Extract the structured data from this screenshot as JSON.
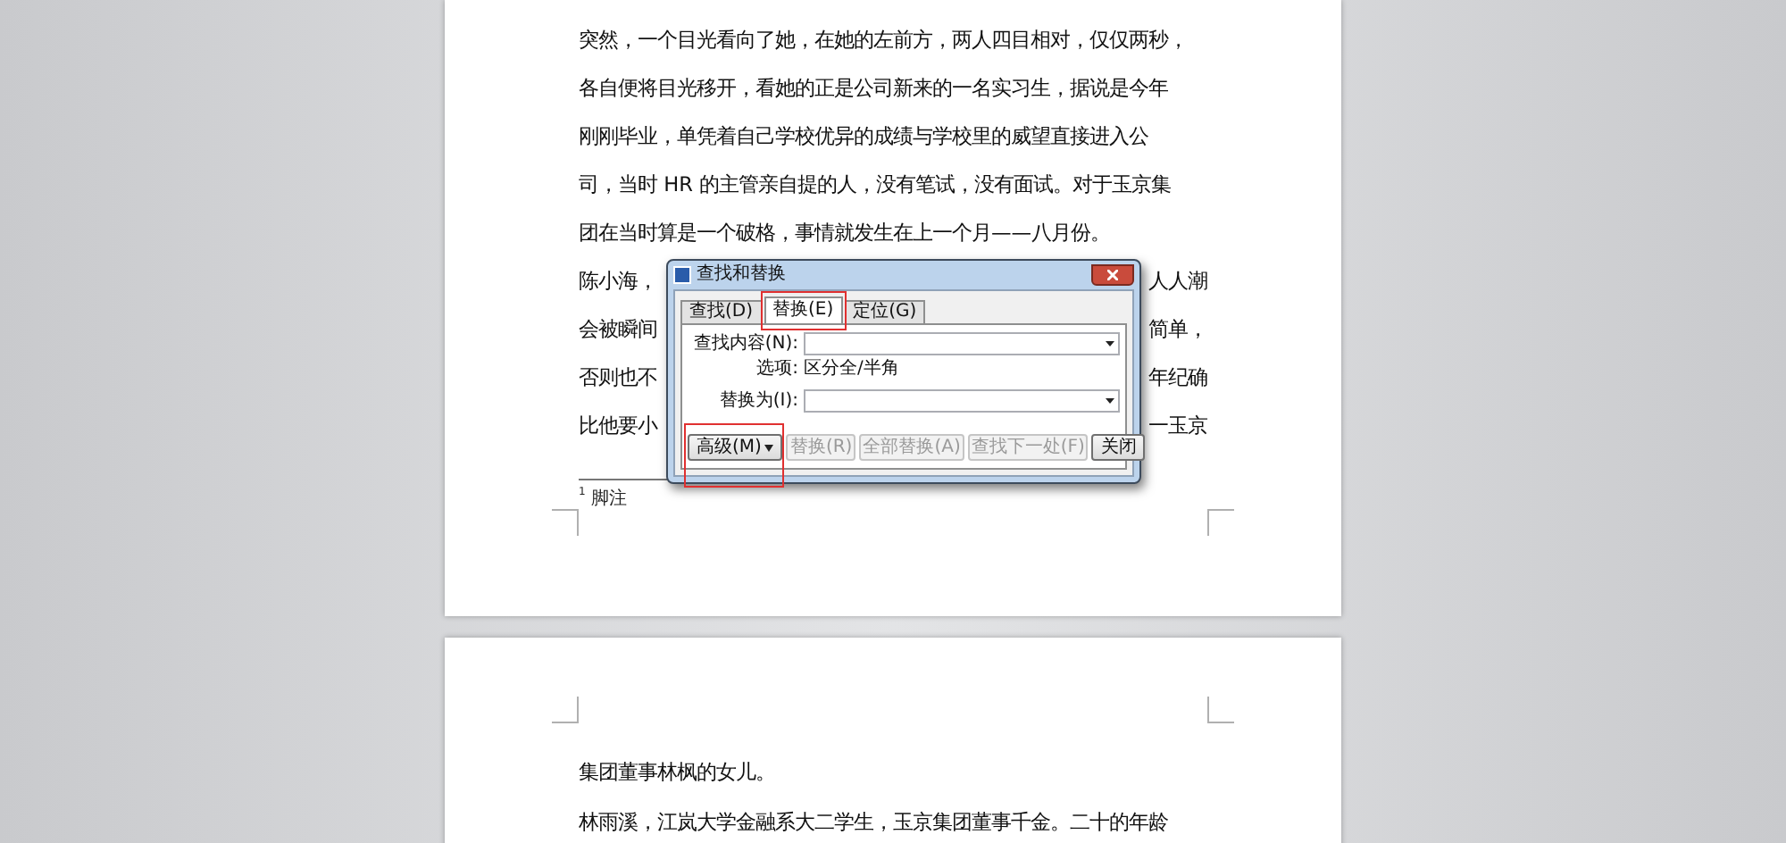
{
  "page_1": {
    "paragraph_lines": [
      "突然，一个目光看向了她，在她的左前方，两人四目相对，仅仅两秒，",
      "各自便将目光移开，看她的正是公司新来的一名实习生，据说是今年",
      "刚刚毕业，单凭着自己学校优异的成绩与学校里的威望直接进入公",
      "司，当时 HR 的主管亲自提的人，没有笔试，没有面试。对于玉京集",
      "团在当时算是一个破格，事情就发生在上一个月——八月份。"
    ],
    "obscured_lines": [
      {
        "left": "陈小海，",
        "right": "人人潮"
      },
      {
        "left": "会被瞬间",
        "right": "简单，"
      },
      {
        "left": "否则也不",
        "right": "年纪确"
      },
      {
        "left": "比他要小",
        "right": "一玉京"
      }
    ],
    "footnote": {
      "mark": "1",
      "text": "脚注"
    }
  },
  "dialog": {
    "title": "查找和替换",
    "tabs": [
      {
        "label": "查找(D)",
        "selected": false
      },
      {
        "label": "替换(E)",
        "selected": true
      },
      {
        "label": "定位(G)",
        "selected": false
      }
    ],
    "find_label": "查找内容(N):",
    "options_label": "选项:",
    "options_value": "区分全/半角",
    "replace_label": "替换为(I):",
    "buttons": [
      {
        "label": "高级(M)",
        "kind": "menu",
        "disabled": false
      },
      {
        "label": "替换(R)",
        "kind": "plain",
        "disabled": true
      },
      {
        "label": "全部替换(A)",
        "kind": "plain",
        "disabled": true
      },
      {
        "label": "查找下一处(F)",
        "kind": "plain",
        "disabled": true
      },
      {
        "label": "关闭",
        "kind": "plain",
        "disabled": false
      }
    ]
  },
  "page_2": {
    "paragraph_lines": [
      "集团董事林枫的女儿。"
    ],
    "next_paragraph_lines": [
      "林雨溪，江岚大学金融系大二学生，玉京集团董事千金。二十的年龄"
    ]
  }
}
